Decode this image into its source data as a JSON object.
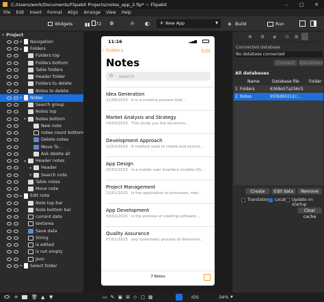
{
  "window": {
    "title": "C:/Users/work/Documents/Flipabit Projects/notes_app_2.fip* ~ Flipabit"
  },
  "menu": [
    "File",
    "Edit",
    "Insert",
    "Format",
    "Align",
    "Arrange",
    "View",
    "Help"
  ],
  "toolbar": {
    "add": "+",
    "widgets": "Widgets",
    "page_count": "72",
    "new_app": "New App",
    "build": "Build",
    "run": "Run"
  },
  "tree": [
    {
      "label": "Project",
      "level": 0,
      "icon": "none",
      "selected": false
    },
    {
      "label": "Navigation",
      "level": 1,
      "icon": "page-icon",
      "selected": false
    },
    {
      "label": "Folders",
      "level": 1,
      "icon": "page-icon",
      "selected": false
    },
    {
      "label": "Folders top",
      "level": 2,
      "icon": "folder-icon",
      "selected": false
    },
    {
      "label": "Folders bottom",
      "level": 2,
      "icon": "folder-icon",
      "selected": false
    },
    {
      "label": "Table folders",
      "level": 2,
      "icon": "table-icon",
      "selected": false
    },
    {
      "label": "Header folder",
      "level": 2,
      "icon": "folder-icon",
      "selected": false
    },
    {
      "label": "Folders to delete",
      "level": 2,
      "icon": "folder-icon",
      "selected": false
    },
    {
      "label": "Notes to delete",
      "level": 2,
      "icon": "folder-icon",
      "selected": false
    },
    {
      "label": "Notes",
      "level": 1,
      "icon": "page-icon",
      "selected": true
    },
    {
      "label": "Search group",
      "level": 2,
      "icon": "folder-icon",
      "selected": false
    },
    {
      "label": "Notes top",
      "level": 2,
      "icon": "folder-icon",
      "selected": false
    },
    {
      "label": "Notes bottom",
      "level": 2,
      "icon": "folder-icon",
      "selected": false
    },
    {
      "label": "New note",
      "level": 3,
      "icon": "folder-icon",
      "selected": false
    },
    {
      "label": "notes count bottom",
      "level": 3,
      "icon": "text-icon",
      "selected": false
    },
    {
      "label": "Delete notes",
      "level": 3,
      "icon": "button-icon",
      "selected": false
    },
    {
      "label": "Move To...",
      "level": 3,
      "icon": "button-icon",
      "selected": false
    },
    {
      "label": "Ask delete all",
      "level": 3,
      "icon": "folder-icon",
      "selected": false
    },
    {
      "label": "Header notes",
      "level": 2,
      "icon": "folder-icon",
      "selected": false
    },
    {
      "label": "Header",
      "level": 3,
      "icon": "folder-icon",
      "selected": false
    },
    {
      "label": "Search note",
      "level": 3,
      "icon": "folder-icon",
      "selected": false
    },
    {
      "label": "Table notes",
      "level": 2,
      "icon": "table-icon",
      "selected": false
    },
    {
      "label": "Move note",
      "level": 2,
      "icon": "folder-icon",
      "selected": false
    },
    {
      "label": "Edit note",
      "level": 1,
      "icon": "page-icon",
      "selected": false
    },
    {
      "label": "Note top bar",
      "level": 2,
      "icon": "folder-icon",
      "selected": false
    },
    {
      "label": "Note bottom bar",
      "level": 2,
      "icon": "folder-icon",
      "selected": false
    },
    {
      "label": "current date",
      "level": 2,
      "icon": "text-icon",
      "selected": false
    },
    {
      "label": "textarea",
      "level": 2,
      "icon": "text-icon",
      "selected": false
    },
    {
      "label": "Save data",
      "level": 2,
      "icon": "button-icon",
      "selected": false
    },
    {
      "label": "String",
      "level": 2,
      "icon": "text-icon",
      "selected": false
    },
    {
      "label": "is edited",
      "level": 2,
      "icon": "text-icon",
      "selected": false
    },
    {
      "label": "is not empty",
      "level": 2,
      "icon": "text-icon",
      "selected": false
    },
    {
      "label": "Json",
      "level": 2,
      "icon": "text-icon",
      "selected": false
    },
    {
      "label": "Select folder",
      "level": 1,
      "icon": "page-icon",
      "selected": false
    }
  ],
  "phone": {
    "time": "11:16",
    "back": "Folders",
    "edit": "Edit",
    "title": "Notes",
    "search_placeholder": "Search",
    "notes": [
      {
        "title": "Idea Generation",
        "date": "21/06/2023",
        "preview": "It is a creative process that..."
      },
      {
        "title": "Market Analysis and Strategy",
        "date": "14/03/2023",
        "preview": "This study you the dynamics..."
      },
      {
        "title": "Development Approach",
        "date": "12/02/2023",
        "preview": "A method used to create and evolve..."
      },
      {
        "title": "App Design",
        "date": "05/02/2023",
        "preview": "is a mobile user interface (mobile UI)..."
      },
      {
        "title": "Project Management",
        "date": "12/01/2023",
        "preview": "is the application of processes, met..."
      },
      {
        "title": "App Development",
        "date": "09/01/2023",
        "preview": "is the process of creating software..."
      },
      {
        "title": "Quality Assurance",
        "date": "07/01/2023",
        "preview": "any systematic process of determini..."
      }
    ],
    "count": "7 Notes"
  },
  "right": {
    "connected_label": "Connected database",
    "connected_value": "No database connected",
    "connect": "Connect",
    "disconnect": "Disconnect",
    "all_label": "All databases",
    "cols": [
      "Name",
      "Database file",
      "Folder"
    ],
    "rows": [
      {
        "idx": "1",
        "name": "Folders",
        "file": "6368e57a256c5",
        "sel": false
      },
      {
        "idx": "2",
        "name": "Notes",
        "file": "95fdd60212c...",
        "sel": true
      }
    ],
    "create": "Create",
    "edit_data": "Edit data",
    "remove": "Remove",
    "translation": "Translation",
    "local": "Local",
    "update": "Update on startup",
    "clear": "Clear cache"
  },
  "bottom": {
    "select_folder": "Select folder",
    "os": "iOS",
    "zoom": "34%"
  },
  "colors": {
    "accent": "#1e6fd9",
    "ios_orange": "#f0a030"
  }
}
